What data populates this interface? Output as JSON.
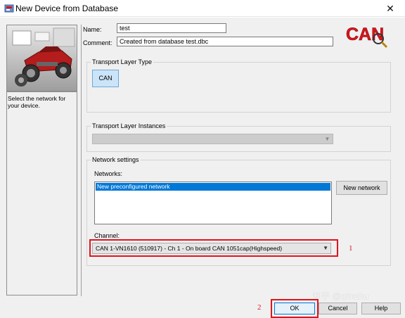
{
  "window": {
    "title": "New Device from Database",
    "close_glyph": "✕",
    "icon": "can-app-icon"
  },
  "left_panel": {
    "image": "car-chassis-picture",
    "hint_text": "Select the network for your device."
  },
  "form": {
    "name_label": "Name:",
    "name_value": "test",
    "comment_label": "Comment:",
    "comment_value": "Created from database test.dbc"
  },
  "logo": {
    "text": "CAN",
    "color": "#d8141e"
  },
  "transport_layer_type": {
    "title": "Transport Layer Type",
    "button_label": "CAN"
  },
  "transport_layer_instances": {
    "title": "Transport Layer Instances",
    "selected_value": ""
  },
  "network_settings": {
    "title": "Network settings",
    "networks_label": "Networks:",
    "networks": [
      "New preconfigured network"
    ],
    "new_network_label": "New network",
    "channel_label": "Channel:",
    "channel_value": "CAN 1-VN1610 (510917) - Ch 1 - On board CAN 1051cap(Highspeed)"
  },
  "annotations": {
    "marker_1": "1",
    "marker_2": "2",
    "highlight_color": "#e0141e"
  },
  "buttons": {
    "ok": "OK",
    "cancel": "Cancel",
    "help": "Help"
  },
  "watermark": "知乎 @qfmzhu"
}
